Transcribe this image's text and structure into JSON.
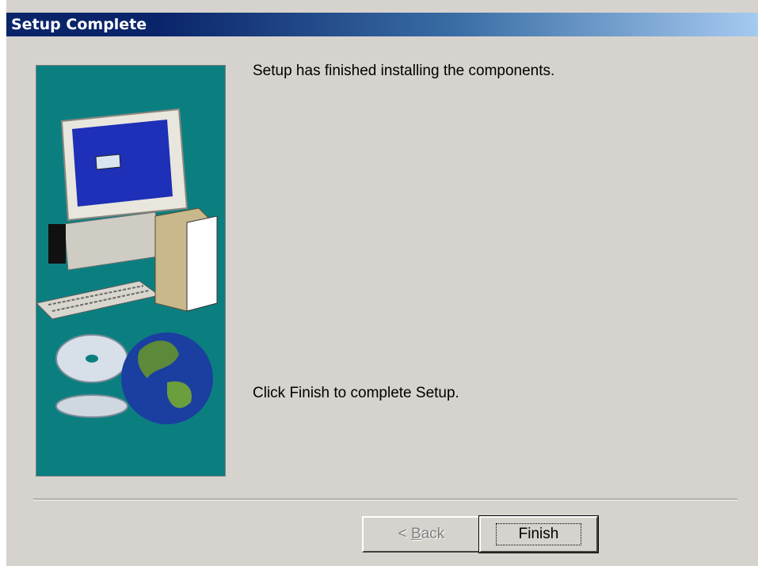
{
  "window": {
    "title": "Setup Complete"
  },
  "main": {
    "message_top": "Setup has finished installing the components.",
    "message_bottom": "Click Finish to complete Setup."
  },
  "buttons": {
    "back_prefix": "< ",
    "back_accel": "B",
    "back_rest": "ack",
    "finish": "Finish"
  },
  "colors": {
    "title_start": "#0a246a",
    "title_end": "#a6caf0",
    "dialog_bg": "#d6d3ce",
    "panel_bg": "#0b7f80"
  }
}
